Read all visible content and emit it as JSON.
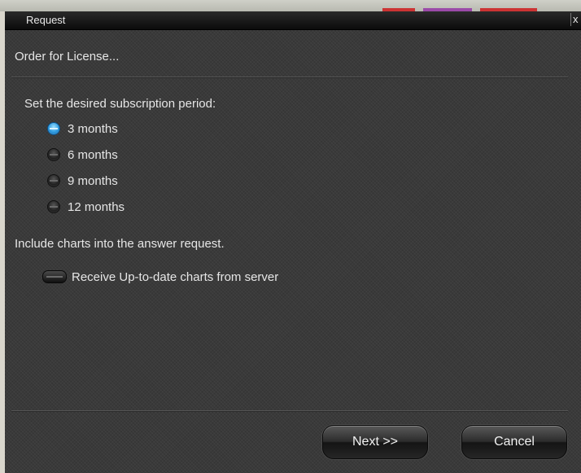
{
  "window": {
    "title": "Request",
    "close_symbol": "x"
  },
  "header": {
    "text": "Order for License..."
  },
  "period": {
    "label": "Set the desired subscription period:",
    "options": [
      {
        "label": "3 months",
        "checked": true
      },
      {
        "label": "6 months",
        "checked": false
      },
      {
        "label": "9 months",
        "checked": false
      },
      {
        "label": "12 months",
        "checked": false
      }
    ]
  },
  "charts": {
    "label": "Include charts into the answer request.",
    "checkbox_label": "Receive Up-to-date charts from server",
    "checked": false
  },
  "buttons": {
    "next": "Next >>",
    "cancel": "Cancel"
  },
  "colors": {
    "accent": "#2f9be0",
    "background": "#3a3a3a",
    "titlebar": "#111111"
  }
}
